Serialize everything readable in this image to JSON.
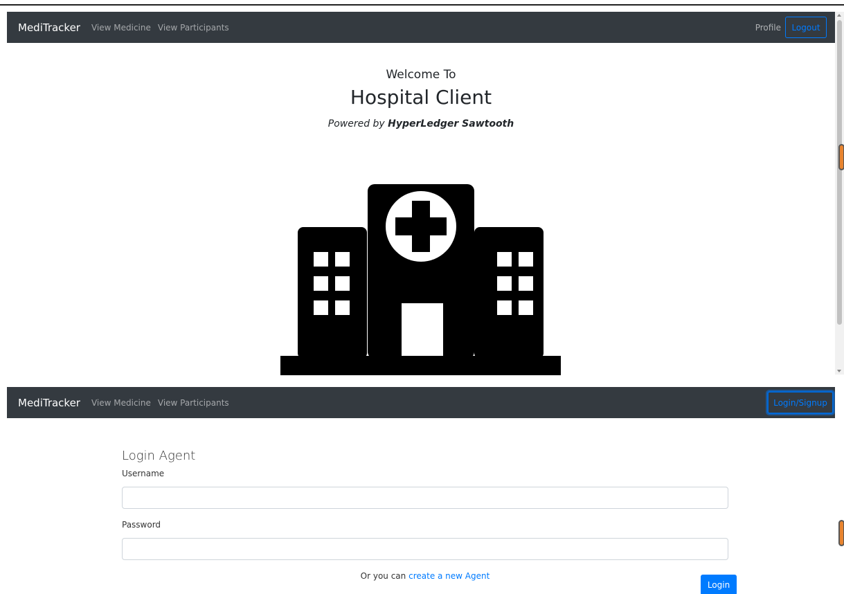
{
  "top_view": {
    "navbar": {
      "brand": "MediTracker",
      "links": [
        "View Medicine",
        "View Participants"
      ],
      "profile": "Profile",
      "logout": "Logout"
    },
    "hero": {
      "welcome": "Welcome To",
      "title": "Hospital Client",
      "powered_prefix": "Powered by",
      "powered_name": "HyperLedger Sawtooth"
    }
  },
  "bottom_view": {
    "navbar": {
      "brand": "MediTracker",
      "links": [
        "View Medicine",
        "View Participants"
      ],
      "login_signup": "Login/Signup"
    },
    "login_form": {
      "title": "Login Agent",
      "username_label": "Username",
      "username_value": "",
      "password_label": "Password",
      "password_value": "",
      "alt_prefix": "Or you can",
      "alt_link": "create a new Agent",
      "submit": "Login"
    }
  },
  "icons": [
    "hospital-building-icon"
  ],
  "colors": {
    "navbar_bg": "#343a40",
    "primary": "#007bff",
    "scroll_thumb": "#e8842f"
  }
}
